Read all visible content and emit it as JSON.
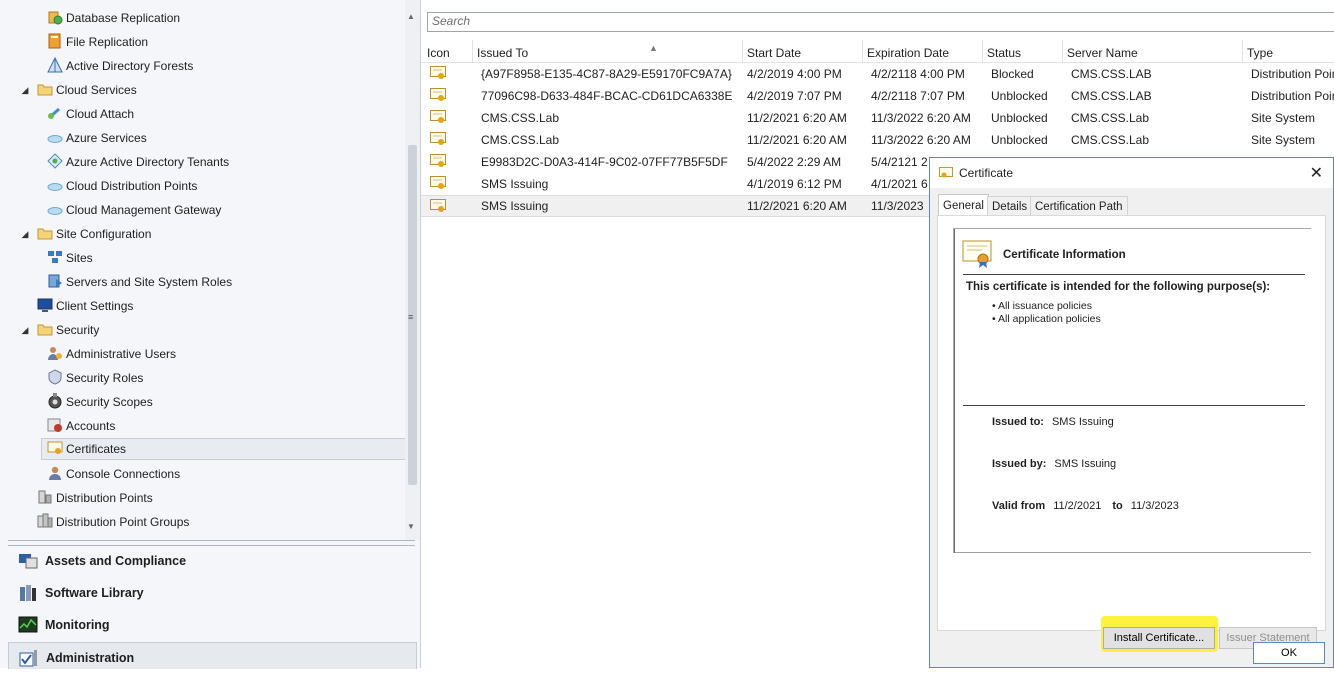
{
  "nav": {
    "tree": [
      {
        "label": "Database Replication",
        "icon": "database-replication-icon"
      },
      {
        "label": "File Replication",
        "icon": "file-replication-icon"
      },
      {
        "label": "Active Directory Forests",
        "icon": "ad-forest-icon"
      },
      {
        "label": "Cloud Services",
        "icon": "folder-icon"
      },
      {
        "label": "Cloud Attach",
        "icon": "cloud-attach-icon"
      },
      {
        "label": "Azure Services",
        "icon": "cloud-icon"
      },
      {
        "label": "Azure Active Directory Tenants",
        "icon": "tenant-icon"
      },
      {
        "label": "Cloud Distribution Points",
        "icon": "cloud-icon"
      },
      {
        "label": "Cloud Management Gateway",
        "icon": "cloud-icon"
      },
      {
        "label": "Site Configuration",
        "icon": "folder-icon"
      },
      {
        "label": "Sites",
        "icon": "sites-icon"
      },
      {
        "label": "Servers and Site System Roles",
        "icon": "server-roles-icon"
      },
      {
        "label": "Client Settings",
        "icon": "monitor-icon"
      },
      {
        "label": "Security",
        "icon": "folder-icon"
      },
      {
        "label": "Administrative Users",
        "icon": "admin-users-icon"
      },
      {
        "label": "Security Roles",
        "icon": "security-roles-icon"
      },
      {
        "label": "Security Scopes",
        "icon": "security-scopes-icon"
      },
      {
        "label": "Accounts",
        "icon": "accounts-icon"
      },
      {
        "label": "Certificates",
        "icon": "certificate-icon"
      },
      {
        "label": "Console Connections",
        "icon": "user-icon"
      },
      {
        "label": "Distribution Points",
        "icon": "distribution-point-icon"
      },
      {
        "label": "Distribution Point Groups",
        "icon": "distribution-group-icon"
      }
    ],
    "workspaces": [
      {
        "label": "Assets and Compliance",
        "icon": "assets-icon"
      },
      {
        "label": "Software Library",
        "icon": "software-library-icon"
      },
      {
        "label": "Monitoring",
        "icon": "monitoring-icon"
      },
      {
        "label": "Administration",
        "icon": "administration-icon"
      }
    ]
  },
  "search": {
    "placeholder": "Search"
  },
  "grid": {
    "columns": [
      "Icon",
      "Issued To",
      "Start Date",
      "Expiration Date",
      "Status",
      "Server Name",
      "Type"
    ],
    "rows": [
      {
        "issued_to": "{A97F8958-E135-4C87-8A29-E59170FC9A7A}",
        "start": "4/2/2019 4:00 PM",
        "expiration": "4/2/2118 4:00 PM",
        "status": "Blocked",
        "server": "CMS.CSS.LAB",
        "type": "Distribution Point"
      },
      {
        "issued_to": "77096C98-D633-484F-BCAC-CD61DCA6338E",
        "start": "4/2/2019 7:07 PM",
        "expiration": "4/2/2118 7:07 PM",
        "status": "Unblocked",
        "server": "CMS.CSS.LAB",
        "type": "Distribution Point"
      },
      {
        "issued_to": "CMS.CSS.Lab",
        "start": "11/2/2021 6:20 AM",
        "expiration": "11/3/2022 6:20 AM",
        "status": "Unblocked",
        "server": "CMS.CSS.Lab",
        "type": "Site System"
      },
      {
        "issued_to": "CMS.CSS.Lab",
        "start": "11/2/2021 6:20 AM",
        "expiration": "11/3/2022 6:20 AM",
        "status": "Unblocked",
        "server": "CMS.CSS.Lab",
        "type": "Site System"
      },
      {
        "issued_to": "E9983D2C-D0A3-414F-9C02-07FF77B5F5DF",
        "start": "5/4/2022 2:29 AM",
        "expiration": "5/4/2121 2",
        "status": "",
        "server": "",
        "type": ""
      },
      {
        "issued_to": "SMS Issuing",
        "start": "4/1/2019 6:12 PM",
        "expiration": "4/1/2021 6",
        "status": "",
        "server": "",
        "type": ""
      },
      {
        "issued_to": "SMS Issuing",
        "start": "11/2/2021 6:20 AM",
        "expiration": "11/3/2023",
        "status": "",
        "server": "",
        "type": ""
      }
    ]
  },
  "dialog": {
    "title": "Certificate",
    "tabs": [
      "General",
      "Details",
      "Certification Path"
    ],
    "info_title": "Certificate Information",
    "purpose_heading": "This certificate is intended for the following purpose(s):",
    "purposes": [
      "All issuance policies",
      "All application policies"
    ],
    "issued_to_label": "Issued to:",
    "issued_to": "SMS Issuing",
    "issued_by_label": "Issued by:",
    "issued_by": "SMS Issuing",
    "valid_from_label": "Valid from",
    "valid_from": "11/2/2021",
    "to_label": "to",
    "valid_to": "11/3/2023",
    "install_button": "Install Certificate...",
    "issuer_button": "Issuer Statement",
    "ok_button": "OK",
    "highlight_color": "#fff12a"
  },
  "colors": {
    "accent": "#5b88c4",
    "nav_bg": "#f4f6f9"
  }
}
